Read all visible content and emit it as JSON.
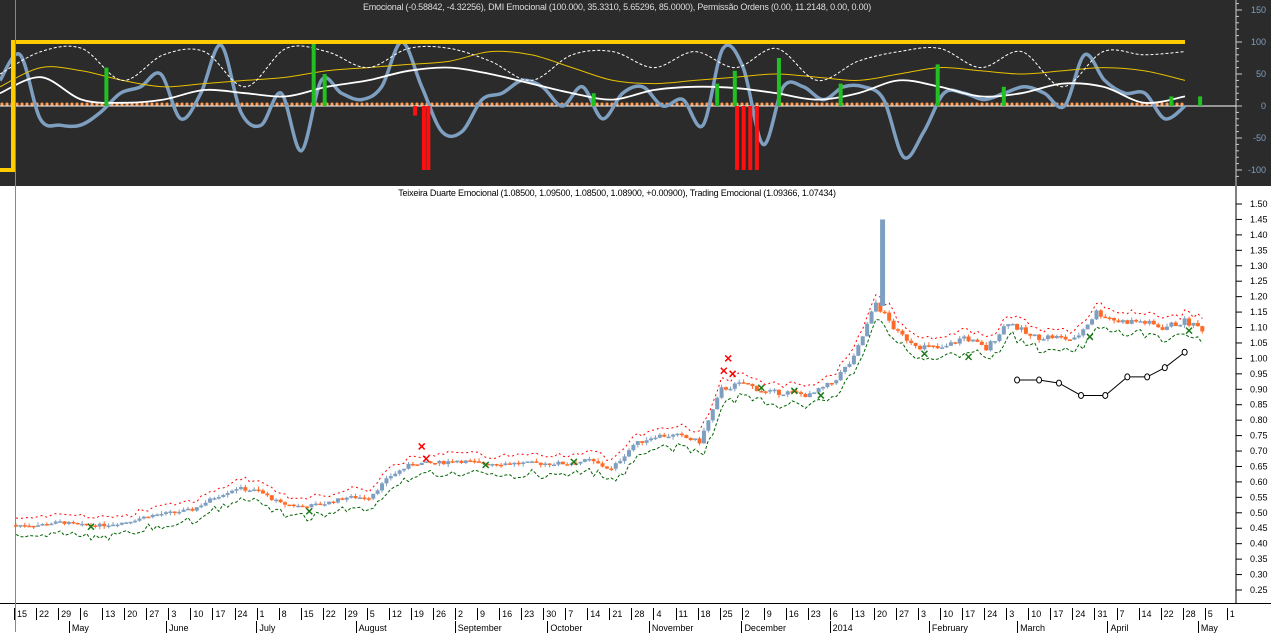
{
  "indicator_title": "Emocional (-0.58842, -4.32256), DMI Emocional (100.000, 35.3310, 5.65296, 85.0000), Permissão Ordens (0.00, 11.2148, 0.00, 0.00)",
  "price_title": "Teixeira Duarte Emocional (1.08500, 1.09500, 1.08500, 1.08900, +0.00900), Trading Emocional (1.09366, 1.07434)",
  "chart_data": [
    {
      "type": "line",
      "name": "indicator-pane",
      "ylim": [
        -110,
        160
      ],
      "yticks": [
        "150",
        "100",
        "50",
        "0",
        "-50",
        "-100"
      ],
      "ytick_values": [
        150,
        100,
        50,
        0,
        -50,
        -100
      ],
      "series": [
        {
          "name": "Emocional",
          "color": "#7f9fc0",
          "values": [
            40,
            80,
            -20,
            -30,
            -30,
            -10,
            20,
            30,
            50,
            -20,
            20,
            95,
            -10,
            -30,
            20,
            -70,
            40,
            20,
            10,
            30,
            100,
            30,
            -40,
            -40,
            10,
            20,
            40,
            30,
            0,
            30,
            -20,
            20,
            30,
            0,
            10,
            -30,
            90,
            60,
            -60,
            30,
            30,
            10,
            30,
            30,
            10,
            -80,
            -40,
            20,
            20,
            10,
            20,
            30,
            20,
            0,
            80,
            40,
            20,
            20,
            -20,
            0
          ]
        },
        {
          "name": "DMI",
          "color": "#ffffff",
          "values": [
            20,
            45,
            10,
            5,
            10,
            25,
            20,
            15,
            30,
            40,
            55,
            60,
            50,
            35,
            20,
            10,
            25,
            30,
            28,
            20,
            10,
            20,
            40,
            30,
            15,
            20,
            35,
            30,
            5,
            15
          ]
        },
        {
          "name": "DMI signal",
          "color": "#e8c000",
          "values": [
            30,
            60,
            55,
            40,
            30,
            35,
            40,
            45,
            55,
            60,
            65,
            70,
            85,
            80,
            60,
            40,
            35,
            40,
            45,
            50,
            45,
            40,
            50,
            60,
            55,
            50,
            55,
            60,
            55,
            40
          ]
        },
        {
          "name": "DMI dashed",
          "color": "#ffffff",
          "values": [
            50,
            85,
            90,
            40,
            80,
            85,
            30,
            90,
            85,
            60,
            90,
            90,
            70,
            40,
            80,
            85,
            60,
            85,
            60,
            90,
            40,
            70,
            85,
            90,
            60,
            85,
            30,
            85,
            80,
            85
          ]
        }
      ],
      "level": 100,
      "sell_bars": [
        {
          "week": 18.1,
          "value": -15
        },
        {
          "week": 18.5,
          "value": -100
        },
        {
          "week": 18.7,
          "value": -100
        },
        {
          "week": 32.7,
          "value": -100
        },
        {
          "week": 33.0,
          "value": -100
        },
        {
          "week": 33.3,
          "value": -100
        },
        {
          "week": 33.6,
          "value": -100
        }
      ],
      "buy_bars": [
        {
          "week": 4.1,
          "value": 60
        },
        {
          "week": 13.5,
          "value": 100
        },
        {
          "week": 14.0,
          "value": 50
        },
        {
          "week": 26.2,
          "value": 20
        },
        {
          "week": 31.8,
          "value": 35
        },
        {
          "week": 32.6,
          "value": 55
        },
        {
          "week": 34.6,
          "value": 75
        },
        {
          "week": 37.4,
          "value": 35
        },
        {
          "week": 41.8,
          "value": 65
        },
        {
          "week": 44.8,
          "value": 30
        },
        {
          "week": 52.4,
          "value": 15
        },
        {
          "week": 53.7,
          "value": 15
        }
      ]
    },
    {
      "type": "candlestick",
      "name": "price-pane",
      "ylim": [
        0.22,
        1.53
      ],
      "yticks": [
        "1.50",
        "1.45",
        "1.40",
        "1.35",
        "1.30",
        "1.25",
        "1.20",
        "1.15",
        "1.10",
        "1.05",
        "1.00",
        "0.95",
        "0.90",
        "0.85",
        "0.80",
        "0.75",
        "0.70",
        "0.65",
        "0.60",
        "0.55",
        "0.50",
        "0.45",
        "0.40",
        "0.35",
        "0.30",
        "0.25"
      ],
      "weekly_close": [
        0.46,
        0.46,
        0.47,
        0.46,
        0.46,
        0.47,
        0.49,
        0.5,
        0.51,
        0.55,
        0.58,
        0.57,
        0.53,
        0.52,
        0.53,
        0.55,
        0.55,
        0.62,
        0.66,
        0.66,
        0.67,
        0.66,
        0.66,
        0.66,
        0.66,
        0.66,
        0.67,
        0.64,
        0.72,
        0.75,
        0.75,
        0.73,
        0.9,
        0.92,
        0.89,
        0.89,
        0.88,
        0.92,
        1.0,
        1.18,
        1.08,
        1.04,
        1.03,
        1.07,
        1.03,
        1.12,
        1.07,
        1.07,
        1.06,
        1.15,
        1.12,
        1.12,
        1.1,
        1.12,
        1.09
      ],
      "spike": {
        "week": 39.3,
        "low": 1.17,
        "high": 1.45
      },
      "sell_marks": [
        {
          "week": 32.3,
          "value": 1.0
        },
        {
          "week": 32.1,
          "value": 0.96
        },
        {
          "week": 32.5,
          "value": 0.95
        },
        {
          "week": 18.4,
          "value": 0.715
        },
        {
          "week": 18.6,
          "value": 0.675
        }
      ],
      "buy_marks": [
        {
          "week": 3.4,
          "value": 0.455
        },
        {
          "week": 13.3,
          "value": 0.505
        },
        {
          "week": 21.3,
          "value": 0.655
        },
        {
          "week": 25.3,
          "value": 0.665
        },
        {
          "week": 33.8,
          "value": 0.905
        },
        {
          "week": 35.3,
          "value": 0.895
        },
        {
          "week": 36.5,
          "value": 0.88
        },
        {
          "week": 41.2,
          "value": 1.015
        },
        {
          "week": 43.2,
          "value": 1.005
        },
        {
          "week": 48.7,
          "value": 1.07
        },
        {
          "week": 53.2,
          "value": 1.09
        }
      ],
      "trend_points": {
        "weeks": [
          45.4,
          46.4,
          47.3,
          48.3,
          49.4,
          50.4,
          51.3,
          52.1,
          53.0
        ],
        "values": [
          0.93,
          0.93,
          0.92,
          0.88,
          0.88,
          0.94,
          0.94,
          0.97,
          1.02
        ]
      },
      "colors": {
        "up": "#7f9fc0",
        "down": "#ff6a28",
        "upper": "#ff0000",
        "lower": "#006400"
      }
    },
    {
      "name": "date-axis",
      "days": [
        "15",
        "22",
        "29",
        "6",
        "13",
        "20",
        "27",
        "3",
        "10",
        "17",
        "24",
        "1",
        "8",
        "15",
        "22",
        "29",
        "5",
        "12",
        "19",
        "26",
        "2",
        "9",
        "16",
        "23",
        "30",
        "7",
        "14",
        "21",
        "28",
        "4",
        "11",
        "18",
        "25",
        "2",
        "9",
        "16",
        "23",
        "6",
        "13",
        "20",
        "27",
        "3",
        "10",
        "17",
        "24",
        "3",
        "10",
        "17",
        "24",
        "31",
        "7",
        "14",
        "22",
        "28",
        "5",
        "1"
      ],
      "months": [
        {
          "label": "May",
          "week": 2.4
        },
        {
          "label": "June",
          "week": 6.8
        },
        {
          "label": "July",
          "week": 10.9
        },
        {
          "label": "August",
          "week": 15.4
        },
        {
          "label": "September",
          "week": 19.9
        },
        {
          "label": "October",
          "week": 24.1
        },
        {
          "label": "November",
          "week": 28.7
        },
        {
          "label": "December",
          "week": 32.9
        },
        {
          "label": "2014",
          "week": 36.9
        },
        {
          "label": "February",
          "week": 41.4
        },
        {
          "label": "March",
          "week": 45.4
        },
        {
          "label": "April",
          "week": 49.5
        },
        {
          "label": "May",
          "week": 53.6
        }
      ]
    }
  ]
}
